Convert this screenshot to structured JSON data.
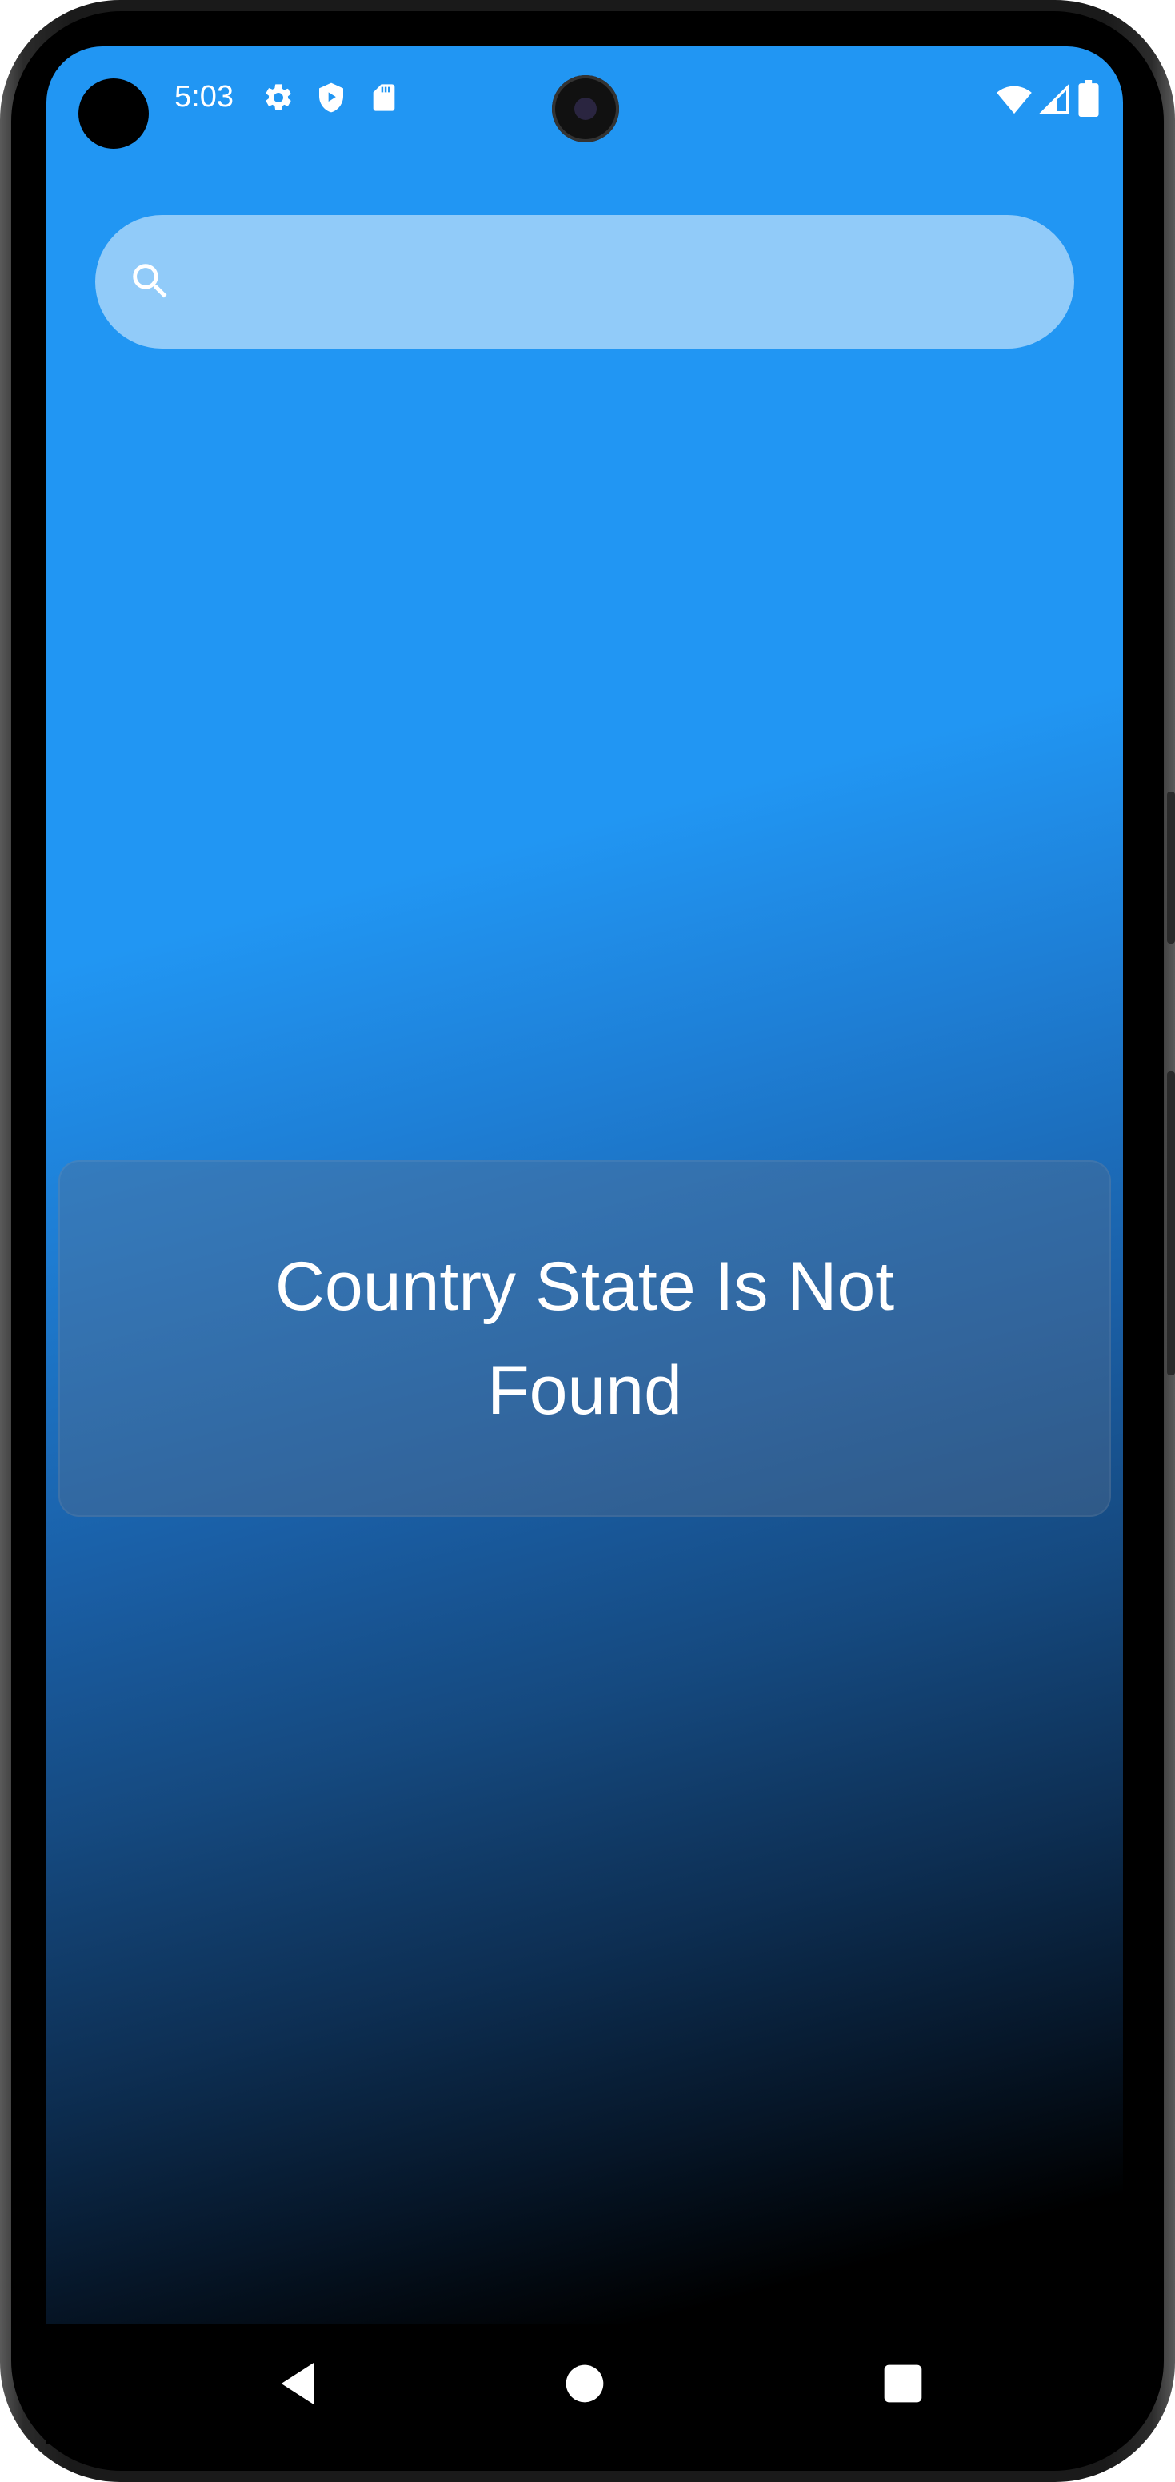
{
  "status_bar": {
    "time": "5:03",
    "left_icons": [
      "gear-icon",
      "shield-play-icon",
      "sd-card-icon"
    ],
    "right_icons": [
      "wifi-icon",
      "signal-icon",
      "battery-icon"
    ]
  },
  "search": {
    "placeholder": "",
    "value": ""
  },
  "message": {
    "text": "Country State Is Not Found"
  },
  "nav": {
    "buttons": [
      "back-icon",
      "home-icon",
      "recents-icon"
    ]
  },
  "colors": {
    "background_top": "#2196f3",
    "background_bottom": "#000000",
    "search_fill": "#91cbf9",
    "text": "#ffffff"
  }
}
